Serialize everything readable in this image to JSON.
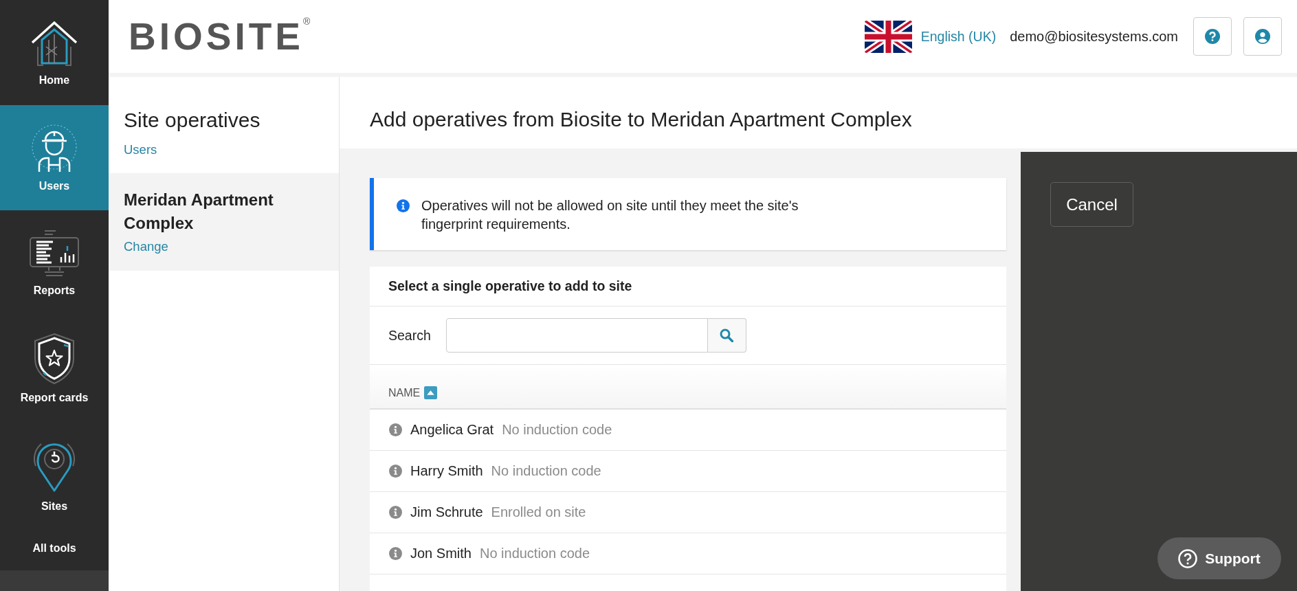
{
  "nav": {
    "items": [
      {
        "label": "Home",
        "kind": "home",
        "selected": false
      },
      {
        "label": "Users",
        "kind": "users",
        "selected": true
      },
      {
        "label": "Reports",
        "kind": "reports",
        "selected": false
      },
      {
        "label": "Report cards",
        "kind": "report-cards",
        "selected": false
      },
      {
        "label": "Sites",
        "kind": "sites",
        "selected": false
      },
      {
        "label": "All tools",
        "kind": "more",
        "selected": false
      }
    ]
  },
  "header": {
    "logo": "BIOSITE$^{®}$",
    "language": "English (UK)",
    "user_email": "demo@biositesystems.com",
    "buttons": [
      {
        "kind": "help"
      },
      {
        "kind": "account"
      }
    ]
  },
  "context_panel": {
    "title": "Site operatives",
    "breadcrumb": "Users",
    "site": {
      "name": "Meridan Apartment Complex",
      "action": "Change"
    }
  },
  "page": {
    "title": "Add operatives from Biosite to Meridan Apartment Complex",
    "notice": "Operatives will not be allowed on site until they meet the site's fingerprint requirements.",
    "panel": {
      "heading": "Select a single operative to add to site",
      "search": {
        "label": "Search"
      }
    },
    "table": {
      "columns": [
        {
          "label": "NAME",
          "sorted_ascending": true
        }
      ],
      "rows": [
        {
          "name": "Angelica Grat",
          "status": "No induction code"
        },
        {
          "name": "Harry Smith",
          "status": "No induction code"
        },
        {
          "name": "Jim Schrute",
          "status": "Enrolled on site"
        },
        {
          "name": "Jon Smith",
          "status": "No induction code"
        }
      ]
    }
  },
  "actions": {
    "cancel": "Cancel"
  },
  "support": {
    "label": "Support"
  }
}
